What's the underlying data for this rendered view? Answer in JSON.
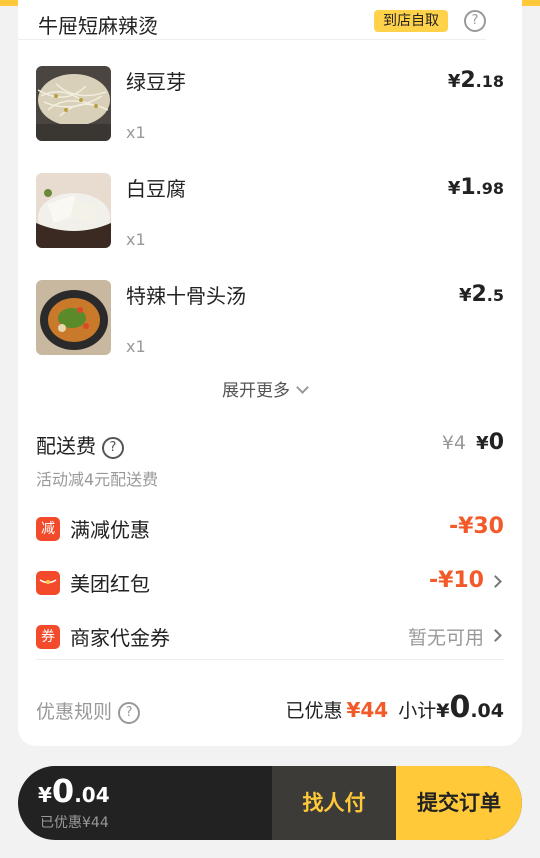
{
  "store": {
    "name": "牛屉短麻辣烫",
    "tag": "到店自取",
    "help": "?"
  },
  "items": [
    {
      "name": "绿豆芽",
      "qty": "x1",
      "yen": "¥",
      "price_int": "2",
      "price_dec": ".18",
      "thumb_icon": "bean-sprouts-photo"
    },
    {
      "name": "白豆腐",
      "qty": "x1",
      "yen": "¥",
      "price_int": "1",
      "price_dec": ".98",
      "thumb_icon": "tofu-photo"
    },
    {
      "name": "特辣十骨头汤",
      "qty": "x1",
      "yen": "¥",
      "price_int": "2",
      "price_dec": ".5",
      "thumb_icon": "bone-soup-photo"
    }
  ],
  "expand_label": "展开更多",
  "delivery": {
    "label": "配送费",
    "help": "?",
    "original": "¥4",
    "yen": "¥",
    "now": "0",
    "note": "活动减4元配送费"
  },
  "discounts": [
    {
      "badge": "减",
      "label": "满减优惠",
      "value": "-¥30"
    },
    {
      "label": "美团红包",
      "value": "-¥10"
    },
    {
      "badge": "券",
      "label": "商家代金券",
      "value": "暂无可用"
    }
  ],
  "summary": {
    "rules_label": "优惠规则",
    "help": "?",
    "saved_label": "已优惠",
    "saved_value": "¥44",
    "subtotal_label": "小计",
    "yen": "¥",
    "total_int": "0",
    "total_dec": ".04"
  },
  "bottom_bar": {
    "yen": "¥",
    "total_int": "0",
    "total_dec": ".04",
    "saved_text": "已优惠¥44",
    "pay_other": "找人付",
    "submit": "提交订单"
  },
  "colors": {
    "accent": "#ffc93a",
    "discount": "#f25a2a",
    "bar": "#222222"
  }
}
